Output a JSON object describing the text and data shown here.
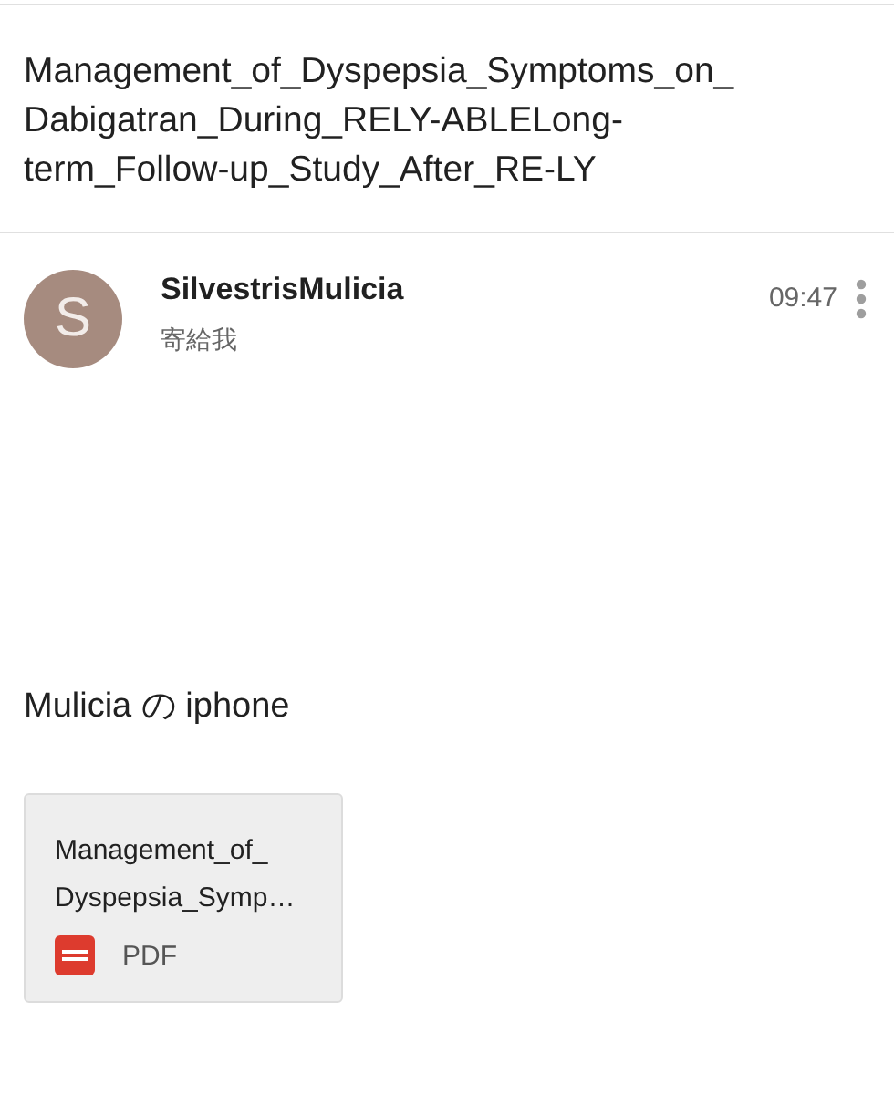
{
  "subject": {
    "lines": [
      "Management_of_Dyspepsia_Symptoms_on_",
      "Dabigatran_During_RELY-ABLELong-",
      "term_Follow-up_Study_After_RE-LY"
    ]
  },
  "message": {
    "avatar_letter": "S",
    "sender": "SilvestrisMulicia",
    "recipient": "寄給我",
    "time": "09:47",
    "body": "Mulicia の iphone",
    "attachments": [
      {
        "name_lines": [
          "Management_of_",
          "Dyspepsia_Symp…"
        ],
        "type": "PDF"
      }
    ]
  }
}
